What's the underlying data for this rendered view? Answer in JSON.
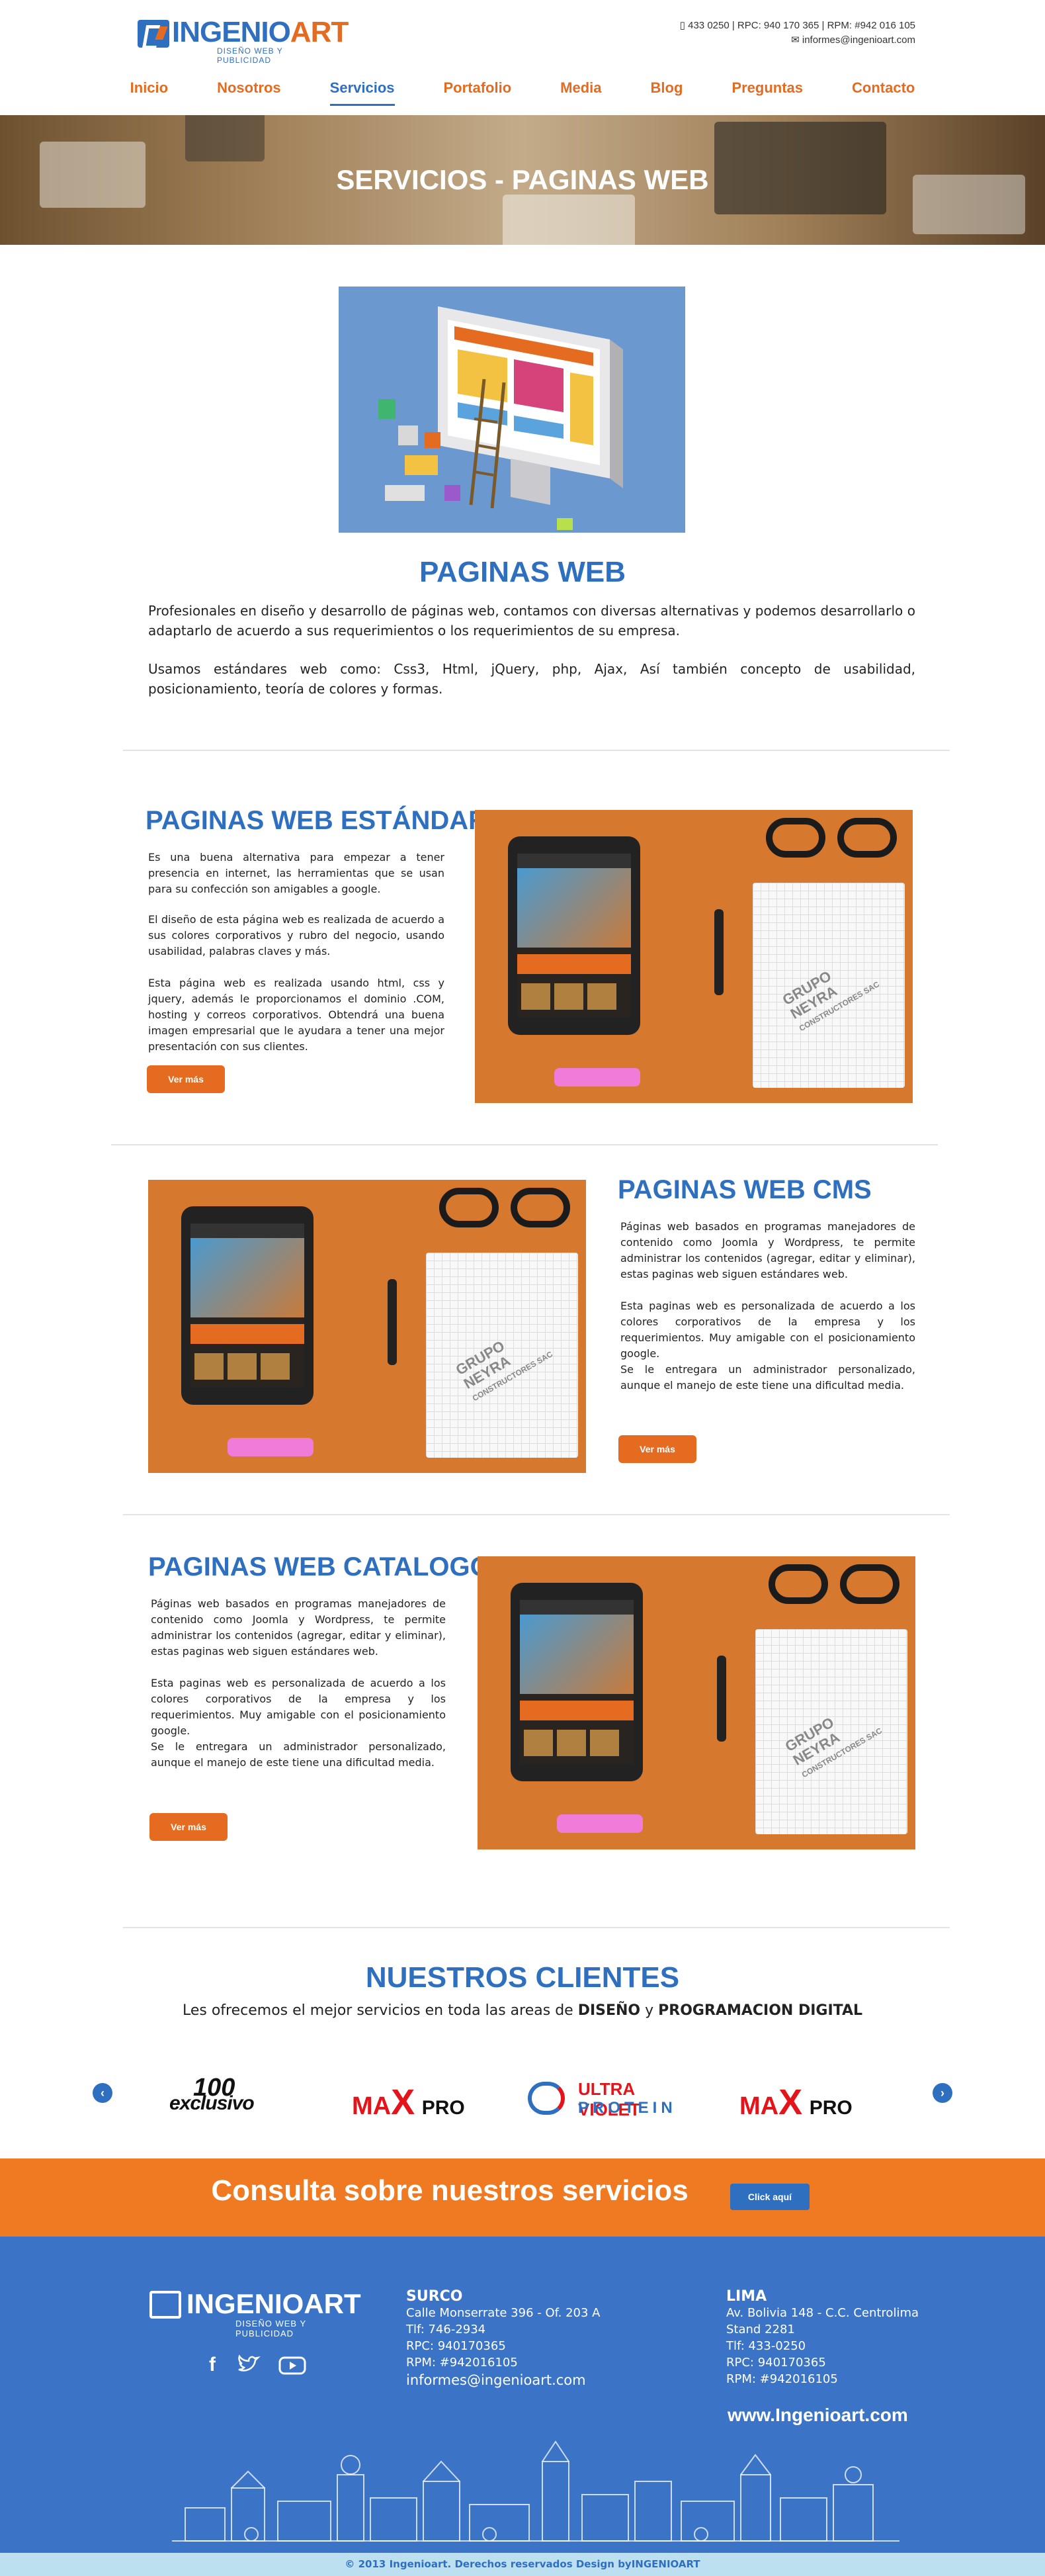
{
  "header": {
    "logo_word_a": "INGENIO",
    "logo_word_b": "ART",
    "logo_tagline": "DISEÑO WEB Y PUBLICIDAD",
    "phone_line": "433 0250 | RPC: 940 170 365 | RPM: #942 016 105",
    "email": "informes@ingenioart.com",
    "nav": [
      "Inicio",
      "Nosotros",
      "Servicios",
      "Portafolio",
      "Media",
      "Blog",
      "Preguntas",
      "Contacto"
    ]
  },
  "banner": {
    "title": "SERVICIOS - PAGINAS WEB"
  },
  "intro": {
    "title": "PAGINAS WEB",
    "p1": "Profesionales en diseño y desarrollo de páginas web, contamos con diversas alternativas y podemos desarrollarlo o adaptarlo de acuerdo a sus requerimientos o los requerimientos de su empresa.",
    "p2": "Usamos estándares web como: Css3, Html, jQuery, php, Ajax, Así también concepto de usabilidad, posicionamiento, teoría de colores y formas."
  },
  "standard": {
    "title": "PAGINAS WEB ESTÁNDAR",
    "p1": "Es una buena alternativa para empezar a tener presencia en internet, las herramientas que se usan para su confección son amigables a google.",
    "p2": "El diseño de esta página web es realizada de acuerdo a sus colores corporativos y rubro del negocio, usando usabilidad, palabras claves y más.",
    "p3": "Esta página web es realizada usando html, css y jquery, además le proporcionamos el dominio .COM, hosting y correos corporativos. Obtendrá una buena imagen empresarial que le ayudara a tener una mejor presentación con sus clientes.",
    "button": "Ver más"
  },
  "cms": {
    "title": "PAGINAS WEB CMS",
    "p1": "Páginas web basados en programas manejadores de contenido como Joomla y Wordpress, te permite administrar los contenidos (agregar, editar y eliminar), estas paginas web siguen estándares web.",
    "p2": "Esta paginas web es personalizada de acuerdo a los colores corporativos de la empresa y los requerimientos. Muy amigable con el posicionamiento google.",
    "p3": "Se le entregara un administrador personalizado, aunque el manejo de este tiene una dificultad media.",
    "button": "Ver más"
  },
  "catalog": {
    "title": "PAGINAS WEB CATALOGO",
    "p1": "Páginas web basados en programas manejadores de contenido como Joomla y Wordpress, te permite administrar los contenidos (agregar, editar y eliminar), estas paginas web siguen estándares web.",
    "p2": "Esta paginas web es personalizada de acuerdo a los colores corporativos de la empresa y los requerimientos. Muy amigable con el posicionamiento google.",
    "p3": "Se le entregara un administrador personalizado, aunque el manejo de este tiene una dificultad media.",
    "button": "Ver más"
  },
  "photo_text": {
    "pad_line1": "GRUPO",
    "pad_line2": "NEYRA",
    "pad_line3": "CONSTRUCTORES SAC"
  },
  "clients": {
    "title": "NUESTROS CLIENTES",
    "sub_a": "Les ofrecemos el mejor servicios en toda las areas de ",
    "sub_b": "DISEÑO",
    "sub_c": " y ",
    "sub_d": "PROGRAMACION DIGITAL",
    "logos": {
      "l1_a": "100",
      "l1_b": "exclusivo",
      "l2_a": "MA",
      "l2_b": "X",
      "l2_c": "PRO",
      "l3_a": "ULTRA VIOLET",
      "l3_b": "PROTEIN",
      "l4_a": "MA",
      "l4_b": "X",
      "l4_c": "PRO"
    },
    "prev": "‹",
    "next": "›"
  },
  "cta": {
    "text": "Consulta sobre nuestros servicios",
    "button": "Click aquí"
  },
  "footer": {
    "logo_word": "INGENIOART",
    "logo_tagline": "DISEÑO WEB Y PUBLICIDAD",
    "surco": {
      "title": "SURCO",
      "l1": "Calle Monserrate 396 - Of. 203 A",
      "l2": "Tlf: 746-2934",
      "l3": "RPC: 940170365",
      "l4": "RPM: #942016105",
      "email": "informes@ingenioart.com"
    },
    "lima": {
      "title": "LIMA",
      "l1": "Av. Bolivia 148 - C.C. Centrolima",
      "l2": "Stand 2281",
      "l3": "Tlf: 433-0250",
      "l4": "RPC: 940170365",
      "l5": "RPM: #942016105"
    },
    "web": "www.Ingenioart.com",
    "copyright": "© 2013 Ingenioart. Derechos reservados Design byINGENIOART",
    "social_f": "f"
  },
  "colors": {
    "brand_blue": "#2f6fc0",
    "brand_orange": "#e46b1f",
    "footer_blue": "#3b74c7"
  }
}
